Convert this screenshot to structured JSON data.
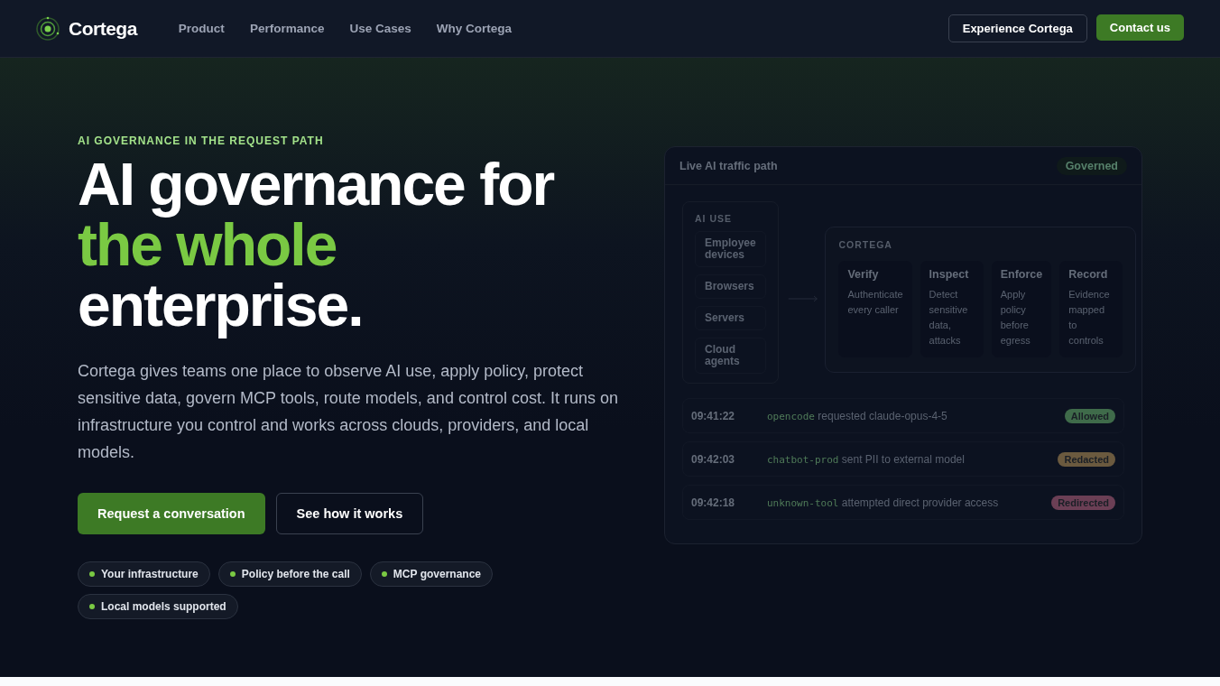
{
  "nav": {
    "brand": "Cortega",
    "links": [
      "Product",
      "Performance",
      "Use Cases",
      "Why Cortega"
    ],
    "secondary_button": "Experience Cortega",
    "primary_button": "Contact us"
  },
  "hero": {
    "eyebrow": "AI GOVERNANCE IN THE REQUEST PATH",
    "title_lines": [
      {
        "text": "AI governance for",
        "accent": false
      },
      {
        "text": "the whole",
        "accent": true
      },
      {
        "text": "enterprise.",
        "accent": false
      }
    ],
    "description": "Cortega gives teams one place to observe AI use, apply policy, protect sensitive data, govern MCP tools, route models, and control cost. It runs on infrastructure you control and works across clouds, providers, and local models.",
    "primary_button": "Request a conversation",
    "secondary_button": "See how it works",
    "tags": [
      "Your infrastructure",
      "Policy before the call",
      "MCP governance",
      "Local models supported"
    ]
  },
  "panel": {
    "title": "Live AI traffic path",
    "badge": "Governed",
    "sources": {
      "heading": "AI USE",
      "items": [
        "Employee devices",
        "Browsers",
        "Servers",
        "Cloud agents"
      ]
    },
    "gateway": {
      "heading": "CORTEGA",
      "steps": [
        {
          "title": "Verify",
          "text": "Authenticate every caller"
        },
        {
          "title": "Inspect",
          "text": "Detect sensitive data, attacks"
        },
        {
          "title": "Enforce",
          "text": "Apply policy before egress"
        },
        {
          "title": "Record",
          "text": "Evidence mapped to controls"
        }
      ]
    },
    "log": [
      {
        "time": "09:41:22",
        "actor": "opencode",
        "message": "requested claude-opus-4-5",
        "status": "Allowed",
        "color": "#3f6b4a"
      },
      {
        "time": "09:42:03",
        "actor": "chatbot-prod",
        "message": "sent PII to external model",
        "status": "Redacted",
        "color": "#6b5a3f"
      },
      {
        "time": "09:42:18",
        "actor": "unknown-tool",
        "message": "attempted direct provider access",
        "status": "Redirected",
        "color": "#6b3f55"
      }
    ]
  }
}
